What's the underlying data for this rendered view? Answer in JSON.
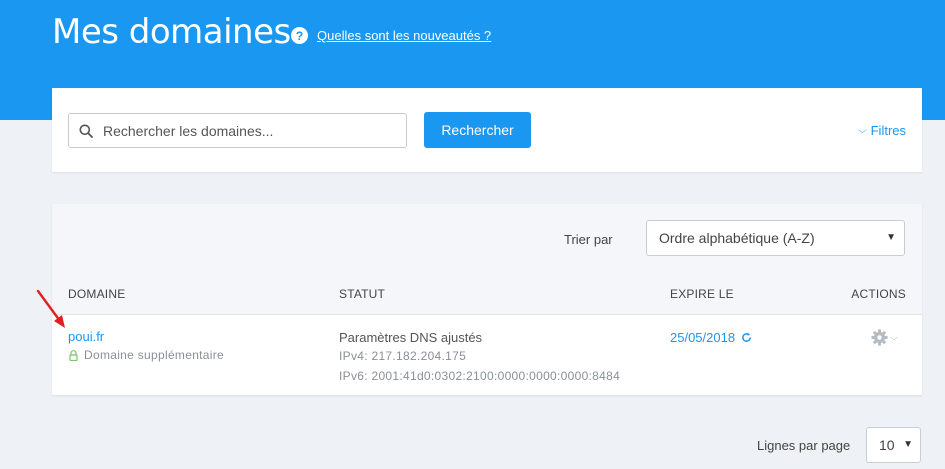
{
  "header": {
    "title": "Mes domaines",
    "help_link": "Quelles sont les nouveautés ?",
    "help_icon_glyph": "?"
  },
  "search": {
    "placeholder": "Rechercher les domaines...",
    "button_label": "Rechercher",
    "filters_label": "Filtres"
  },
  "sort": {
    "label": "Trier par",
    "selected": "Ordre alphabétique (A-Z)"
  },
  "table": {
    "headers": {
      "domain": "DOMAINE",
      "status": "STATUT",
      "expires": "EXPIRE LE",
      "actions": "ACTIONS"
    },
    "rows": [
      {
        "domain": "poui.fr",
        "domain_type": "Domaine supplémentaire",
        "status": "Paramètres DNS ajustés",
        "ipv4": "IPv4: 217.182.204.175",
        "ipv6": "IPv6: 2001:41d0:0302:2100:0000:0000:0000:8484",
        "expires": "25/05/2018"
      }
    ]
  },
  "pagination": {
    "rows_per_page_label": "Lignes par page",
    "rows_per_page_value": "10"
  },
  "colors": {
    "brand": "#1a97f0",
    "annotation_arrow": "#e02020"
  }
}
